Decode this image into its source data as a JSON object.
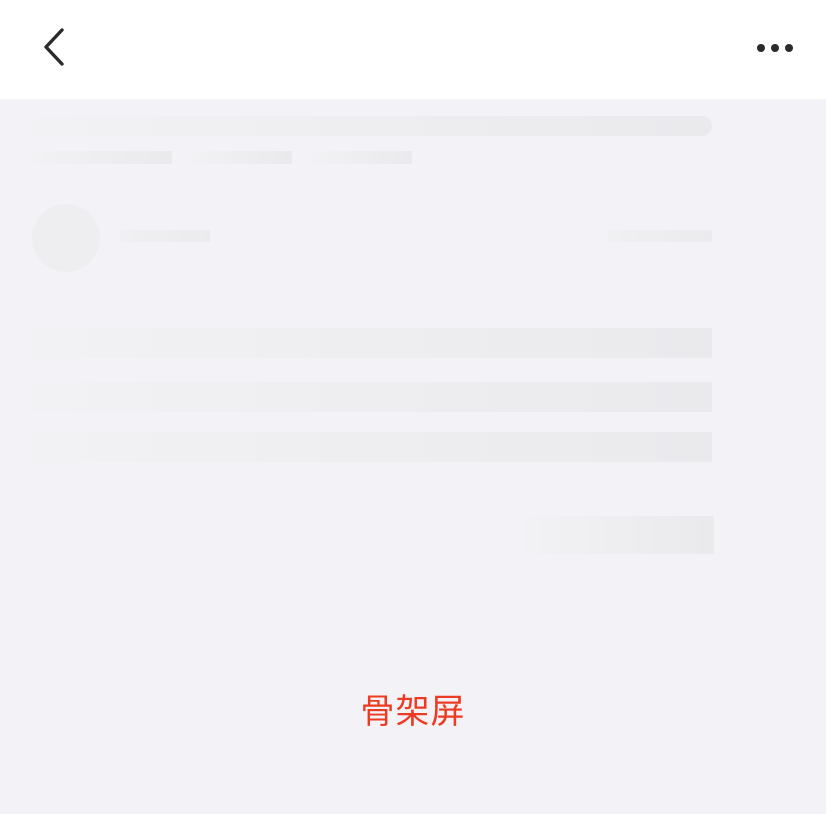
{
  "header": {
    "back_icon": "chevron-left-icon",
    "more_icon": "more-horizontal-icon"
  },
  "skeleton": {
    "state": "loading placeholder"
  },
  "caption": {
    "text": "骨架屏",
    "color": "#ec3b22"
  },
  "colors": {
    "page_background": "#f3f3f7",
    "header_background": "#ffffff",
    "placeholder": "#ebebee"
  }
}
